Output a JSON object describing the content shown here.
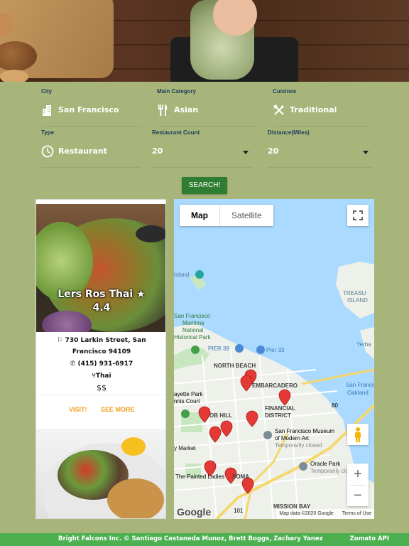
{
  "filters": {
    "city": {
      "label": "City",
      "value": "San Francisco",
      "icon": "city-icon"
    },
    "main_category": {
      "label": "Main Category",
      "value": "Asian",
      "icon": "utensils-icon"
    },
    "cuisines": {
      "label": "Cuisines",
      "value": "Traditional",
      "icon": "cutlery-cross-icon"
    },
    "type": {
      "label": "Type",
      "value": "Restaurant",
      "icon": "clock-icon"
    },
    "restaurant_count": {
      "label": "Restaurant Count",
      "value": "20"
    },
    "distance": {
      "label": "Distance(Miles)",
      "value": "20"
    }
  },
  "search_label": "SEARCH!",
  "restaurant": {
    "name": "Lers Ros Thai",
    "rating": "4.4",
    "star": "★",
    "address": "730 Larkin Street, San Francisco 94109",
    "phone": "(415) 931-6917",
    "cuisine": "Thai",
    "price": "$$",
    "visit_label": "VISIT!",
    "see_more_label": "SEE MORE"
  },
  "map": {
    "map_tab": "Map",
    "satellite_tab": "Satellite",
    "zoom_in": "+",
    "zoom_out": "−",
    "google_logo": "Google",
    "data_notice": "Map data ©2020 Google",
    "terms": "Terms of Use",
    "labels": {
      "island": "Island",
      "treasure_island_1": "TREASU",
      "treasure_island_2": "ISLAND",
      "maritime_1": "San Francisco",
      "maritime_2": "Maritime",
      "maritime_3": "National",
      "maritime_4": "Historical Park",
      "pier39": "PIER 39",
      "pier33": "Pier 33",
      "north_beach": "NORTH BEACH",
      "embarcadero": "EMBARCADERO",
      "financial_1": "FINANCIAL",
      "financial_2": "DISTRICT",
      "yerba": "Yerba",
      "sf_oakland_1": "San Francisco-",
      "sf_oakland_2": "Oakland",
      "fayette_1": "ayette Park",
      "fayette_2": "nnis Court",
      "nob_hill": "OB HILL",
      "sfmoma_1": "San Francisco Museum",
      "sfmoma_2": "of Modern Art",
      "sfmoma_3": "Temporarily closed",
      "oracle_1": "Oracle Park",
      "oracle_2": "Temporarily close",
      "market": "y Market",
      "painted": "The Painted Ladies",
      "soma": "SOMA",
      "mission_bay": "MISSION BAY",
      "hwy80": "80",
      "hwy101": "101"
    }
  },
  "footer": {
    "credits": "Bright Falcons Inc. © Santiago Castaneda Munoz, Brett Boggs, Zachary Yanez",
    "api": "Zomato API"
  },
  "colors": {
    "background": "#a8b57a",
    "search_button": "#2e7d32",
    "link_accent": "#f0a020",
    "footer": "#4caf50",
    "map_water": "#aadaff",
    "pin": "#e53935"
  }
}
